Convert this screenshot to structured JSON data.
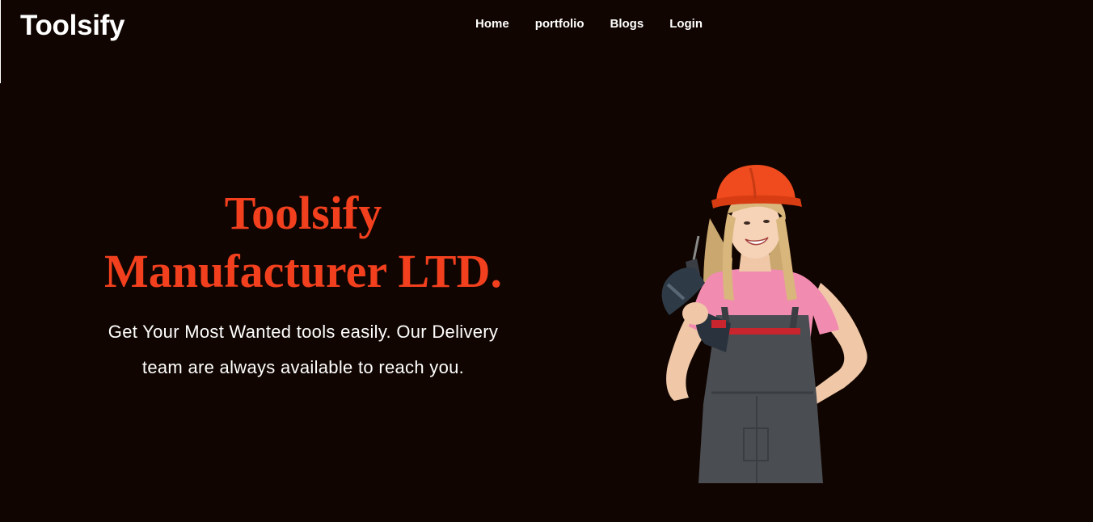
{
  "header": {
    "brand": "Toolsify",
    "nav": [
      {
        "label": "Home"
      },
      {
        "label": "portfolio"
      },
      {
        "label": "Blogs"
      },
      {
        "label": "Login"
      }
    ]
  },
  "hero": {
    "title": "Toolsify Manufacturer LTD.",
    "subtitle": "Get Your Most Wanted tools easily. Our Delivery team are always available to reach you."
  },
  "colors": {
    "background": "#100500",
    "accent": "#f2401e",
    "text": "#ffffff"
  },
  "image": {
    "subject": "worker-with-drill-illustration"
  }
}
